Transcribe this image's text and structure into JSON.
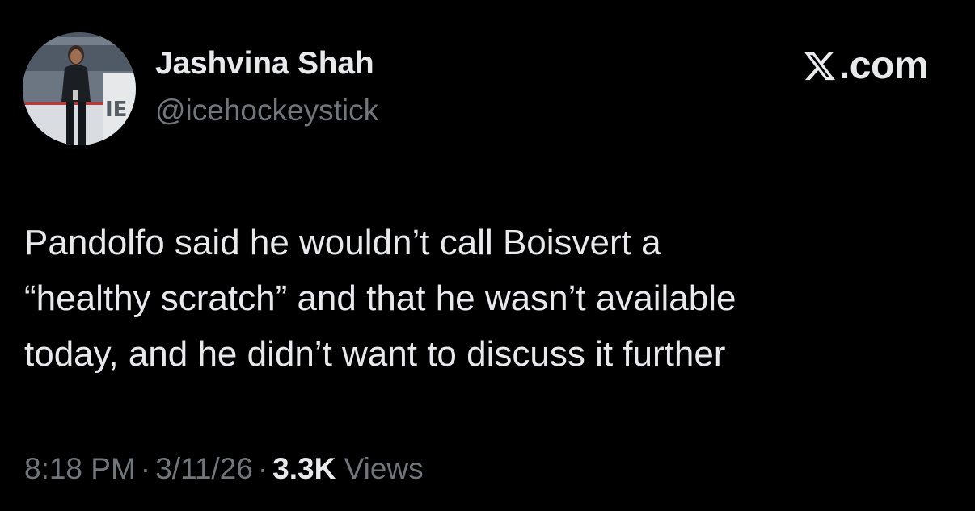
{
  "author": {
    "display_name": "Jashvina Shah",
    "handle": "@icehockeystick"
  },
  "brand": {
    "logo_icon": "x-logo-icon",
    "label": ".com"
  },
  "tweet": {
    "lines": [
      "Pandolfo said he wouldn’t call Boisvert a",
      "“healthy scratch” and that he wasn’t available",
      "today, and he didn’t want to discuss it further"
    ]
  },
  "meta": {
    "time": "8:18 PM",
    "separator": "·",
    "date": "3/11/26",
    "views_count": "3.3K",
    "views_label": "Views"
  },
  "colors": {
    "background": "#000000",
    "primary_text": "#e7e9ea",
    "secondary_text": "#71767b"
  }
}
